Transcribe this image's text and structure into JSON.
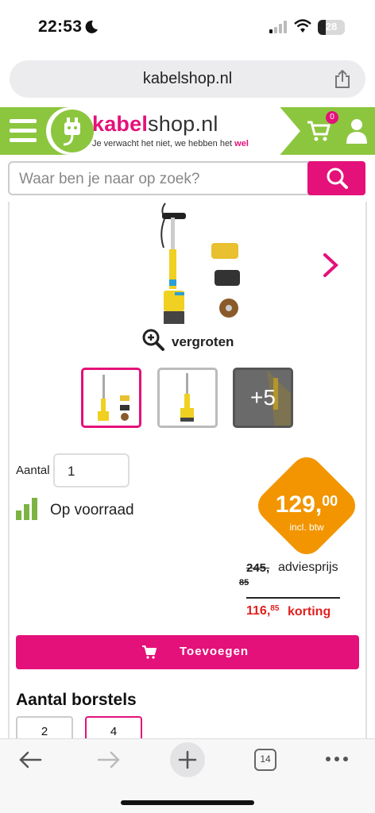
{
  "status": {
    "time": "22:53",
    "battery": "28"
  },
  "browser": {
    "url": "kabelshop.nl",
    "tabs_count": "14"
  },
  "header": {
    "logo_bold": "kabel",
    "logo_rest": "shop.nl",
    "tagline_start": "Je verwacht het niet, we hebben het ",
    "tagline_highlight": "wel",
    "cart_count": "0"
  },
  "search": {
    "placeholder": "Waar ben je naar op zoek?"
  },
  "gallery": {
    "zoom_label": "vergroten",
    "more_label": "+5"
  },
  "product": {
    "qty_label": "Aantal",
    "qty_value": "1",
    "stock_label": "Op voorraad",
    "price_main": "129,",
    "price_cents": "00",
    "price_note": "incl. btw",
    "advice_price": "245,",
    "advice_cents": "85",
    "advice_label": "adviesprijs",
    "discount_main": "116,",
    "discount_cents": "85",
    "discount_label": "korting",
    "add_label": "Toevoegen"
  },
  "options": {
    "title": "Aantal borstels",
    "values": [
      "2",
      "4"
    ],
    "selected": "4"
  },
  "colors": {
    "green": "#8cc63f",
    "pink": "#e4117a",
    "orange": "#f29500",
    "red": "#e02020"
  }
}
